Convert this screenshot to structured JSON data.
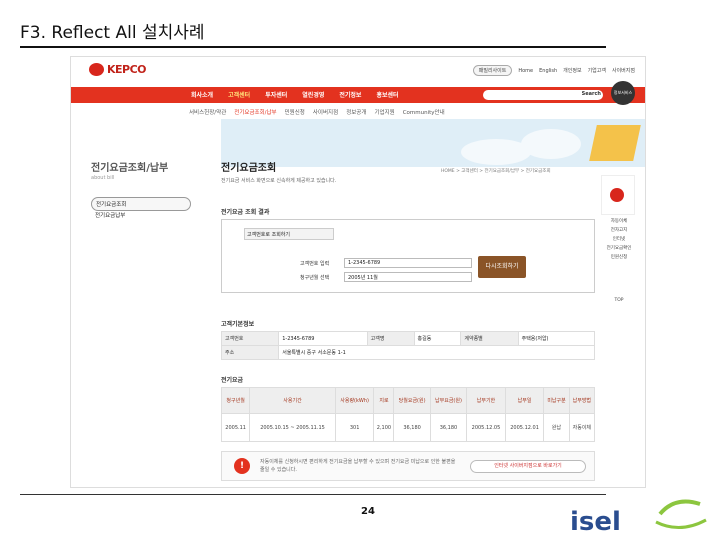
{
  "slide": {
    "title": "F3. Reflect All 설치사례",
    "page_number": "24"
  },
  "site": {
    "logo_text": "KEPCO",
    "util_links": [
      "패밀리사이트",
      "Home",
      "English",
      "개인정보",
      "기업고객",
      "사이버지점"
    ],
    "nav": [
      {
        "label": "회사소개",
        "active": false
      },
      {
        "label": "고객센터",
        "active": true
      },
      {
        "label": "투자센터",
        "active": false
      },
      {
        "label": "열린경영",
        "active": false
      },
      {
        "label": "전기정보",
        "active": false
      },
      {
        "label": "홍보센터",
        "active": false
      }
    ],
    "search_button": "Search",
    "badge": "정보서비스",
    "subnav": [
      {
        "label": "서비스헌장/약관",
        "active": false
      },
      {
        "label": "전기요금조회/납부",
        "active": true
      },
      {
        "label": "민원신청",
        "active": false
      },
      {
        "label": "사이버지점",
        "active": false
      },
      {
        "label": "정보공개",
        "active": false
      },
      {
        "label": "기업지원",
        "active": false
      },
      {
        "label": "Community안내",
        "active": false
      }
    ],
    "sidebar": {
      "heading": "전기요금조회/납부",
      "subheading": "about bill",
      "items": [
        {
          "label": "전기요금조회",
          "active": true
        },
        {
          "label": "전기요금납부",
          "active": false
        }
      ]
    },
    "main": {
      "title": "전기요금조회",
      "description": "전기요금 서비스 화면으로 신속하게 제공하고 있습니다.",
      "breadcrumb": "HOME > 고객센터 > 전기요금조회/납부 > 전기요금조회",
      "result_title": "전기요금 조회 결과",
      "form": {
        "tab": "고객번호로 조회하기",
        "customer_no_label": "고객번호 입력",
        "customer_no_value": "1-2345-6789",
        "bill_month_label": "청구년월 선택",
        "bill_month_value": "2005년 11월",
        "query_button": "다시조회하기"
      },
      "customer_section": {
        "title": "고객기본정보",
        "row1": [
          "고객번호",
          "1-2345-6789",
          "고객명",
          "홍길동",
          "계약종별",
          "주택용(저압)"
        ],
        "row2": [
          "주소",
          "서울특별시 중구 서소문동 1-1"
        ]
      },
      "bill_section": {
        "title": "전기요금",
        "headers": [
          "청구년월",
          "사용기간",
          "사용량(kWh)",
          "지로",
          "당월요금(원)",
          "납부요금(원)",
          "납부기한",
          "납부일",
          "미납구분",
          "납부방법"
        ],
        "row": [
          "2005.11",
          "2005.10.15 ~ 2005.11.15",
          "301",
          "2,100",
          "36,180",
          "36,180",
          "2005.12.05",
          "2005.12.01",
          "완납",
          "자동이체"
        ]
      },
      "notice": {
        "text": "자동이체를 신청하시면 편리하게 전기요금을 납부할 수 있으며 전기요금 미납으로 인한 불편을 줄일 수 있습니다.",
        "button": "인터넷 사이버지점으로 바로가기"
      }
    },
    "rightbox": {
      "links": [
        "자동이체",
        "전자고지",
        "인터넷",
        "전기요금확인",
        "민원신청"
      ],
      "top": "TOP"
    }
  },
  "colors": {
    "kepco_red": "#e3321f",
    "query_button": "#8a5427"
  }
}
